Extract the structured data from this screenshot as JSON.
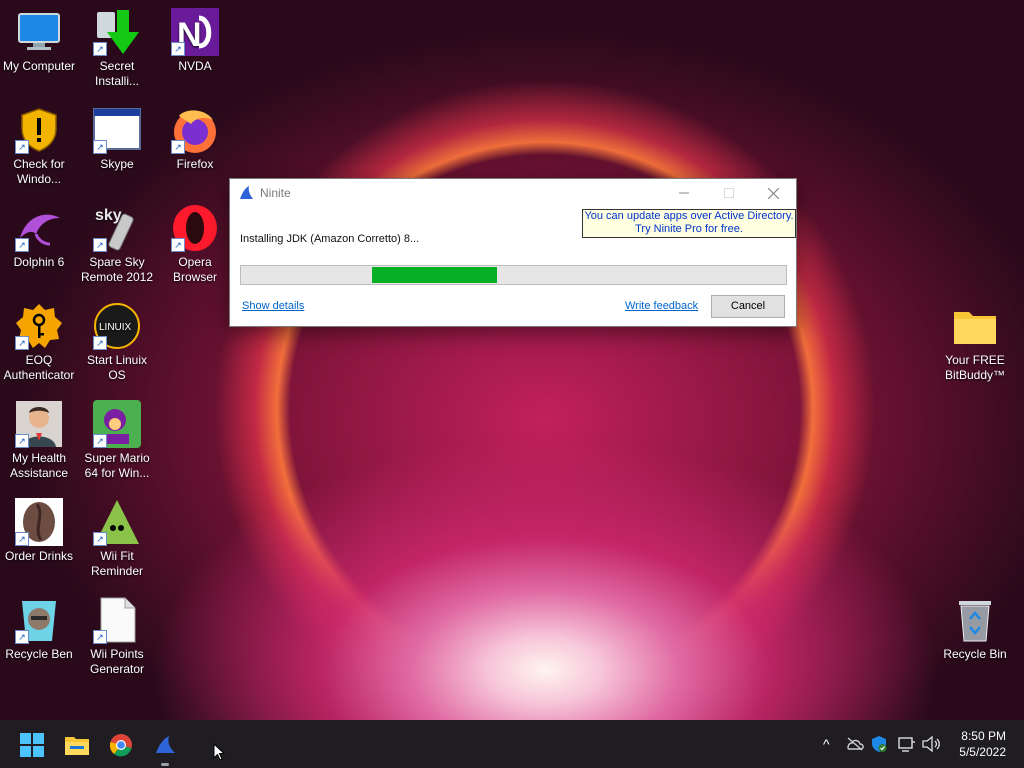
{
  "desktop_icons": [
    {
      "label": "My Computer",
      "shortcut": false
    },
    {
      "label": "Secret Installi...",
      "shortcut": true
    },
    {
      "label": "NVDA",
      "shortcut": true
    },
    {
      "label": "Check for Windo...",
      "shortcut": true
    },
    {
      "label": "Skype",
      "shortcut": true
    },
    {
      "label": "Firefox",
      "shortcut": true
    },
    {
      "label": "Dolphin 6",
      "shortcut": true
    },
    {
      "label": "Spare Sky Remote 2012",
      "shortcut": true
    },
    {
      "label": "Opera Browser",
      "shortcut": true
    },
    {
      "label": "EOQ Authenticator",
      "shortcut": true
    },
    {
      "label": "Start Linuix OS",
      "shortcut": true
    },
    {
      "label": "My Health Assistance",
      "shortcut": true
    },
    {
      "label": "Super Mario 64 for Win...",
      "shortcut": true
    },
    {
      "label": "Order Drinks",
      "shortcut": true
    },
    {
      "label": "Wii Fit Reminder",
      "shortcut": true
    },
    {
      "label": "Recycle Ben",
      "shortcut": true
    },
    {
      "label": "Wii Points Generator",
      "shortcut": true
    },
    {
      "label": "Your FREE BitBuddy™",
      "shortcut": false
    },
    {
      "label": "Recycle Bin",
      "shortcut": false
    }
  ],
  "ninite": {
    "title": "Ninite",
    "promo_line1": "You can update apps over Active Directory.",
    "promo_line2": "Try Ninite Pro for free.",
    "status": "Installing JDK (Amazon Corretto) 8...",
    "show_details": "Show details",
    "write_feedback": "Write feedback",
    "cancel": "Cancel",
    "progress_start": 0.24,
    "progress_end": 0.47
  },
  "taskbar": {
    "time": "8:50 PM",
    "date": "5/5/2022"
  },
  "colors": {
    "progress_fill": "#06b025",
    "promo_bg": "#ffffe1",
    "link": "#0066cc"
  }
}
